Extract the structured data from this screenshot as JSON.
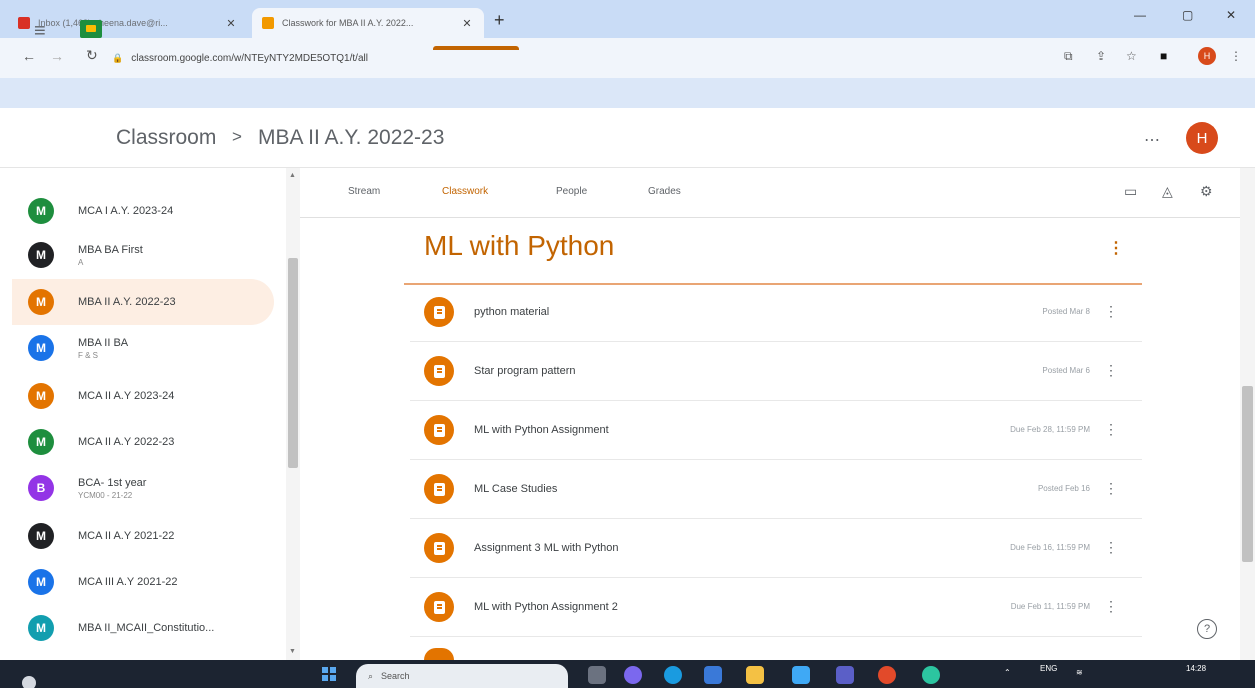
{
  "browser": {
    "tabs": [
      {
        "title": "Inbox (1,468) - heena.dave@ri...",
        "favicon_color": "#d93025",
        "active": false
      },
      {
        "title": "Classwork for MBA II A.Y. 2022...",
        "favicon_color": "#f29900",
        "active": true
      }
    ],
    "new_tab_glyph": "+",
    "url": "classroom.google.com/w/NTEyNTY2MDE5OTQ1/t/all",
    "profile_initial": "H"
  },
  "header": {
    "app_name": "Classroom",
    "separator": ">",
    "class_name": "MBA II A.Y. 2022-23",
    "account_initial": "H"
  },
  "sidebar": {
    "items": [
      {
        "initial": "M",
        "name": "MCA I A.Y. 2023-24",
        "sub": "",
        "color": "#1e8e3e",
        "selected": false
      },
      {
        "initial": "M",
        "name": "MBA BA First",
        "sub": "A",
        "color": "#202124",
        "selected": false
      },
      {
        "initial": "M",
        "name": "MBA II A.Y. 2022-23",
        "sub": "",
        "color": "#e37400",
        "selected": true
      },
      {
        "initial": "M",
        "name": "MBA II BA",
        "sub": "F & S",
        "color": "#1a73e8",
        "selected": false
      },
      {
        "initial": "M",
        "name": "MCA II A.Y 2023-24",
        "sub": "",
        "color": "#e37400",
        "selected": false
      },
      {
        "initial": "M",
        "name": "MCA II A.Y 2022-23",
        "sub": "",
        "color": "#1e8e3e",
        "selected": false
      },
      {
        "initial": "B",
        "name": "BCA- 1st year",
        "sub": "YCM00 - 21-22",
        "color": "#9334e6",
        "selected": false
      },
      {
        "initial": "M",
        "name": "MCA II A.Y 2021-22",
        "sub": "",
        "color": "#202124",
        "selected": false
      },
      {
        "initial": "M",
        "name": "MCA III A.Y 2021-22",
        "sub": "",
        "color": "#1a73e8",
        "selected": false
      },
      {
        "initial": "M",
        "name": "MBA II_MCAII_Constitutio...",
        "sub": "",
        "color": "#129eaf",
        "selected": false
      }
    ]
  },
  "tabs": {
    "items": [
      {
        "label": "Stream",
        "active": false
      },
      {
        "label": "Classwork",
        "active": true
      },
      {
        "label": "People",
        "active": false
      },
      {
        "label": "Grades",
        "active": false
      }
    ]
  },
  "topic": {
    "title": "ML with Python",
    "items": [
      {
        "title": "python material",
        "date": "Posted Mar 8",
        "type": "material"
      },
      {
        "title": "Star program pattern",
        "date": "Posted Mar 6",
        "type": "material"
      },
      {
        "title": "ML with Python Assignment",
        "date": "Due Feb 28, 11:59 PM",
        "type": "assignment"
      },
      {
        "title": "ML Case Studies",
        "date": "Posted Feb 16",
        "type": "material"
      },
      {
        "title": "Assignment 3 ML with Python",
        "date": "Due Feb 16, 11:59 PM",
        "type": "assignment"
      },
      {
        "title": "ML with Python Assignment 2",
        "date": "Due Feb 11, 11:59 PM",
        "type": "assignment"
      }
    ]
  },
  "taskbar": {
    "search_placeholder": "Search",
    "lang": "ENG",
    "time": "14:28"
  },
  "colors": {
    "accent": "#c26401",
    "item_icon": "#e37400",
    "selected_bg": "#fdeee3"
  }
}
